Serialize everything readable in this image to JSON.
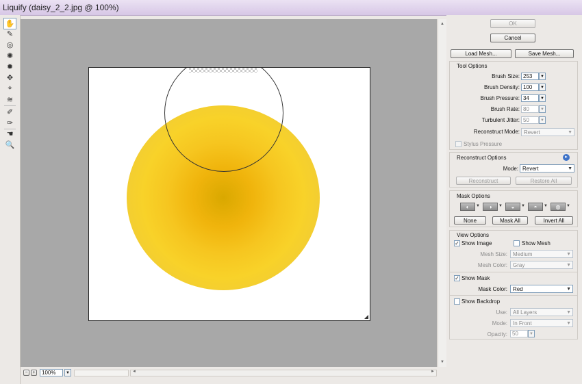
{
  "window": {
    "title": "Liquify (daisy_2_2.jpg @ 100%)"
  },
  "tools": [
    {
      "name": "forward-warp-tool-icon",
      "glyph": "✋"
    },
    {
      "name": "reconstruct-tool-icon",
      "glyph": "✎"
    },
    {
      "name": "twirl-clockwise-tool-icon",
      "glyph": "◎"
    },
    {
      "name": "pucker-tool-icon",
      "glyph": "✺"
    },
    {
      "name": "bloat-tool-icon",
      "glyph": "✹"
    },
    {
      "name": "push-left-tool-icon",
      "glyph": "✥"
    },
    {
      "name": "mirror-tool-icon",
      "glyph": "⌖"
    },
    {
      "name": "turbulence-tool-icon",
      "glyph": "≋"
    },
    {
      "name": "freeze-mask-tool-icon",
      "glyph": "✐"
    },
    {
      "name": "thaw-mask-tool-icon",
      "glyph": "✑"
    },
    {
      "name": "hand-tool-icon",
      "glyph": "☚"
    },
    {
      "name": "zoom-tool-icon",
      "glyph": "🔍"
    }
  ],
  "buttons": {
    "ok": "OK",
    "cancel": "Cancel",
    "load_mesh": "Load Mesh...",
    "save_mesh": "Save Mesh..."
  },
  "tool_options": {
    "title": "Tool Options",
    "brush_size": {
      "label": "Brush Size:",
      "value": "253"
    },
    "brush_density": {
      "label": "Brush Density:",
      "value": "100"
    },
    "brush_pressure": {
      "label": "Brush Pressure:",
      "value": "34"
    },
    "brush_rate": {
      "label": "Brush Rate:",
      "value": "80"
    },
    "turbulent_jitter": {
      "label": "Turbulent Jitter:",
      "value": "50"
    },
    "reconstruct_mode": {
      "label": "Reconstruct Mode:",
      "value": "Revert"
    },
    "stylus_pressure": "Stylus Pressure"
  },
  "reconstruct_options": {
    "title": "Reconstruct Options",
    "mode_label": "Mode:",
    "mode_value": "Revert",
    "reconstruct_btn": "Reconstruct",
    "restore_all_btn": "Restore All"
  },
  "mask_options": {
    "title": "Mask Options",
    "none": "None",
    "mask_all": "Mask All",
    "invert_all": "Invert All"
  },
  "view_options": {
    "title": "View Options",
    "show_image": "Show Image",
    "show_mesh": "Show Mesh",
    "mesh_size_label": "Mesh Size:",
    "mesh_size_value": "Medium",
    "mesh_color_label": "Mesh Color:",
    "mesh_color_value": "Gray",
    "show_mask": "Show Mask",
    "mask_color_label": "Mask Color:",
    "mask_color_value": "Red",
    "show_backdrop": "Show Backdrop",
    "use_label": "Use:",
    "use_value": "All Layers",
    "mode_label": "Mode:",
    "mode_value": "In Front",
    "opacity_label": "Opacity:",
    "opacity_value": "50"
  },
  "status": {
    "zoom": "100%"
  }
}
